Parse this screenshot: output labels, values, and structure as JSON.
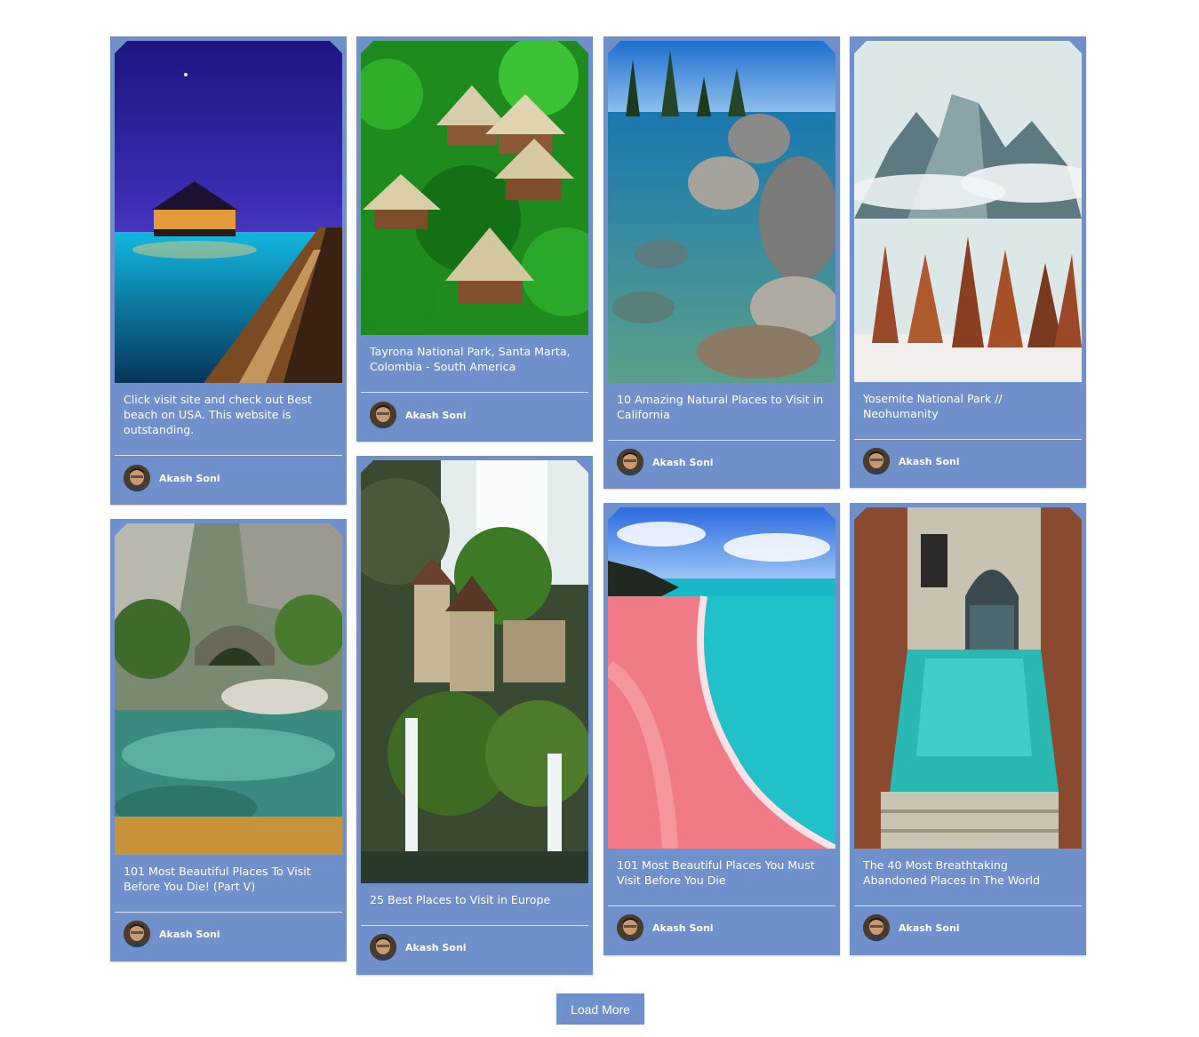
{
  "author_name": "Akash Soni",
  "load_more_label": "Load More",
  "colors": {
    "card": "#7090cc",
    "button": "#7090cc",
    "page": "#ffffff"
  },
  "cards": [
    {
      "caption": "Click visit site and check out Best beach on USA. This website is outstanding.",
      "image": "overwater-bungalow-night-image"
    },
    {
      "caption": "Tayrona National Park, Santa Marta, Colombia - South America",
      "image": "jungle-huts-image"
    },
    {
      "caption": "10 Amazing Natural Places to Visit in California",
      "image": "lake-rocks-image"
    },
    {
      "caption": "Yosemite National Park // Neohumanity",
      "image": "snowy-mountain-forest-image"
    },
    {
      "caption": "101 Most Beautiful Places To Visit Before You Die! (Part V)",
      "image": "river-stone-bridge-image"
    },
    {
      "caption": "25 Best Places to Visit in Europe",
      "image": "waterfall-castle-image"
    },
    {
      "caption": "101 Most Beautiful Places You Must Visit Before You Die",
      "image": "pink-beach-image"
    },
    {
      "caption": "The 40 Most Breathtaking Abandoned Places In The World",
      "image": "flooded-doorway-image"
    }
  ]
}
